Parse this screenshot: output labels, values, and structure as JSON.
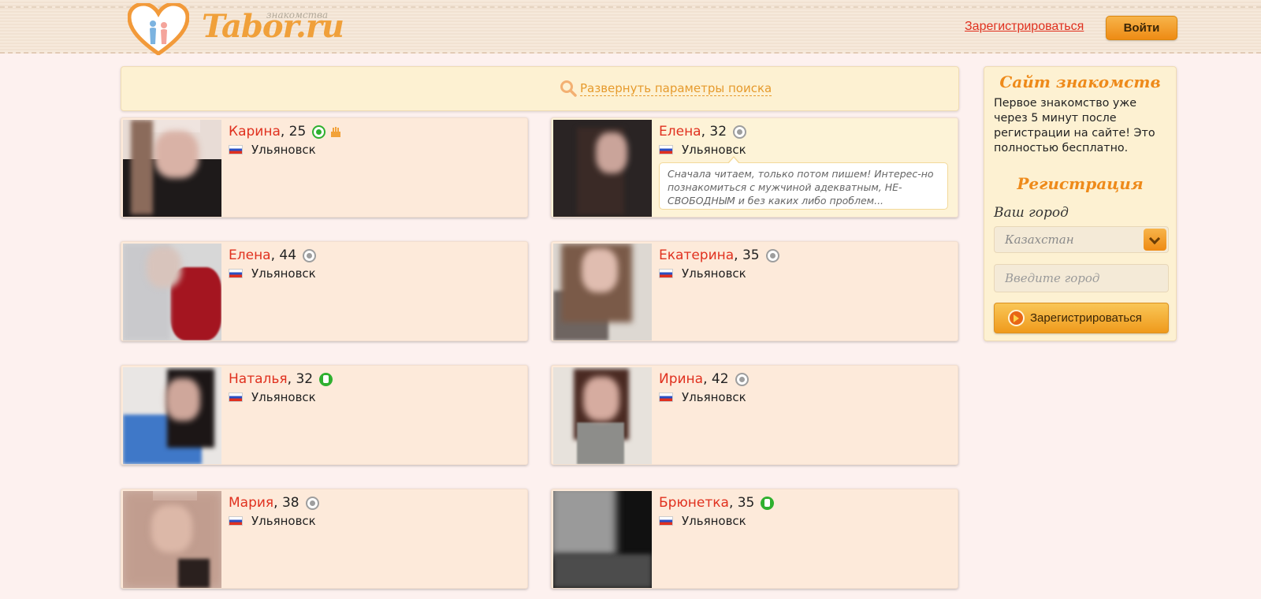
{
  "header": {
    "logo_text": "Tabor.ru",
    "logo_sub": "знакомства",
    "register_link": "Зарегистрироваться",
    "login_button": "Войти"
  },
  "search": {
    "expand_label": "Развернуть параметры поиска",
    "icon": "search-icon"
  },
  "profiles": [
    {
      "name": "Карина",
      "age": ", 25",
      "city": "Ульяновск",
      "status": "online",
      "birthday": true
    },
    {
      "name": "Елена",
      "age": ", 32",
      "city": "Ульяновск",
      "status": "offline",
      "quote": "Сначала читаем, только потом пишем! Интерес-но познакомиться с мужчиной адекватным, НЕ-СВОБОДНЫМ и без каких либо проблем..."
    },
    {
      "name": "Елена",
      "age": ", 44",
      "city": "Ульяновск",
      "status": "offline"
    },
    {
      "name": "Екатерина",
      "age": ", 35",
      "city": "Ульяновск",
      "status": "offline"
    },
    {
      "name": "Наталья",
      "age": ", 32",
      "city": "Ульяновск",
      "status": "mobile"
    },
    {
      "name": "Ирина",
      "age": ", 42",
      "city": "Ульяновск",
      "status": "offline"
    },
    {
      "name": "Мария",
      "age": ", 38",
      "city": "Ульяновск",
      "status": "offline"
    },
    {
      "name": "Брюнетка",
      "age": ", 35",
      "city": "Ульяновск",
      "status": "mobile"
    }
  ],
  "sidebar": {
    "title": "Сайт знакомств",
    "text": "Первое знакомство уже через 5 минут после регистрации на сайте! Это полностью бесплатно.",
    "reg_title": "Регистрация",
    "city_label": "Ваш город",
    "country_select": "Казахстан",
    "city_placeholder": "Введите город",
    "register_button": "Зарегистрироваться"
  },
  "colors": {
    "accent": "#ee8a1a",
    "name": "#e0311f",
    "card_bg": "#fdeada",
    "page_bg": "#fdf1ef"
  }
}
